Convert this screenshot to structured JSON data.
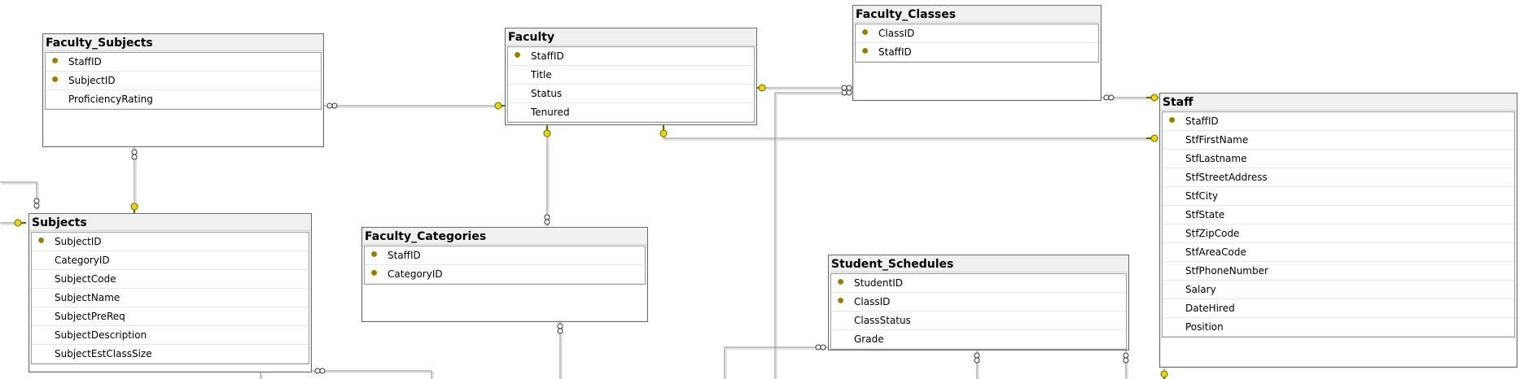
{
  "tables": {
    "faculty_subjects": {
      "title": "Faculty_Subjects",
      "columns": [
        {
          "name": "StaffID",
          "key": true
        },
        {
          "name": "SubjectID",
          "key": true
        },
        {
          "name": "ProficiencyRating",
          "key": false
        }
      ]
    },
    "faculty": {
      "title": "Faculty",
      "columns": [
        {
          "name": "StaffID",
          "key": true
        },
        {
          "name": "Title",
          "key": false
        },
        {
          "name": "Status",
          "key": false
        },
        {
          "name": "Tenured",
          "key": false
        }
      ]
    },
    "faculty_classes": {
      "title": "Faculty_Classes",
      "columns": [
        {
          "name": "ClassID",
          "key": true
        },
        {
          "name": "StaffID",
          "key": true
        }
      ]
    },
    "staff": {
      "title": "Staff",
      "columns": [
        {
          "name": "StaffID",
          "key": true
        },
        {
          "name": "StfFirstName",
          "key": false
        },
        {
          "name": "StfLastname",
          "key": false
        },
        {
          "name": "StfStreetAddress",
          "key": false
        },
        {
          "name": "StfCity",
          "key": false
        },
        {
          "name": "StfState",
          "key": false
        },
        {
          "name": "StfZipCode",
          "key": false
        },
        {
          "name": "StfAreaCode",
          "key": false
        },
        {
          "name": "StfPhoneNumber",
          "key": false
        },
        {
          "name": "Salary",
          "key": false
        },
        {
          "name": "DateHired",
          "key": false
        },
        {
          "name": "Position",
          "key": false
        }
      ]
    },
    "subjects": {
      "title": "Subjects",
      "columns": [
        {
          "name": "SubjectID",
          "key": true
        },
        {
          "name": "CategoryID",
          "key": false
        },
        {
          "name": "SubjectCode",
          "key": false
        },
        {
          "name": "SubjectName",
          "key": false
        },
        {
          "name": "SubjectPreReq",
          "key": false
        },
        {
          "name": "SubjectDescription",
          "key": false
        },
        {
          "name": "SubjectEstClassSize",
          "key": false
        }
      ]
    },
    "faculty_categories": {
      "title": "Faculty_Categories",
      "columns": [
        {
          "name": "StaffID",
          "key": true
        },
        {
          "name": "CategoryID",
          "key": true
        }
      ]
    },
    "student_schedules": {
      "title": "Student_Schedules",
      "columns": [
        {
          "name": "StudentID",
          "key": true
        },
        {
          "name": "ClassID",
          "key": true
        },
        {
          "name": "ClassStatus",
          "key": false
        },
        {
          "name": "Grade",
          "key": false
        }
      ]
    }
  },
  "icons": {
    "primary_key": "key-icon",
    "one_end": "key-connector-icon",
    "many_end": "infinity-connector-icon"
  },
  "colors": {
    "line": "#8a8a8a",
    "key": "#e8d800",
    "header_bg": "#f0f0f0"
  }
}
